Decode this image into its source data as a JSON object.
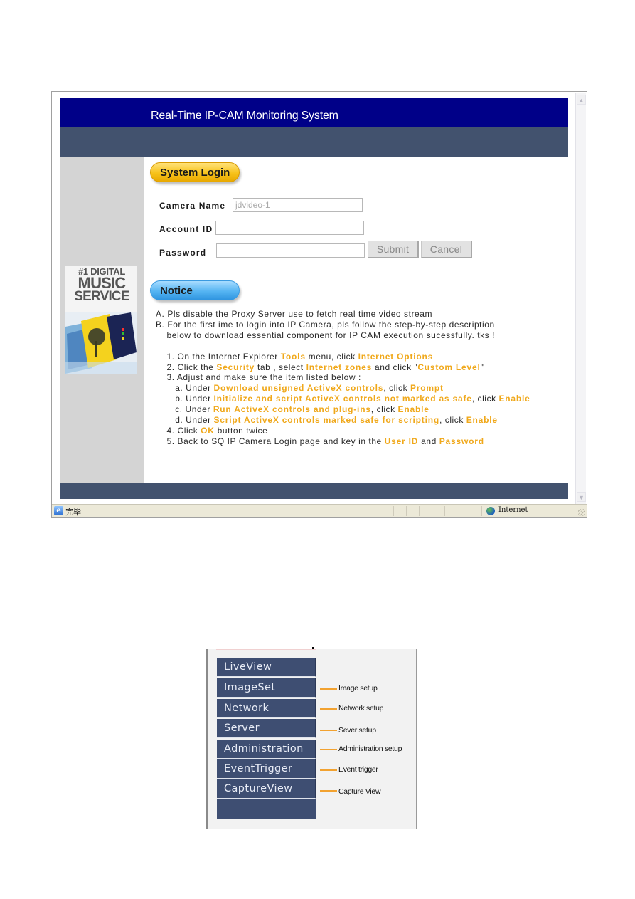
{
  "browser": {
    "header_title": "Real-Time IP-CAM Monitoring System",
    "ad": {
      "line1": "#1 DIGITAL",
      "line2": "MUSIC",
      "line3": "SERVICE"
    },
    "login": {
      "section_title": "System Login",
      "camera_name_label": "Camera Name",
      "camera_name_value": "jdvideo-1",
      "account_id_label": "Account ID",
      "account_id_value": "",
      "password_label": "Password",
      "password_value": "",
      "submit_label": "Submit",
      "cancel_label": "Cancel"
    },
    "notice": {
      "section_title": "Notice",
      "lines": [
        [
          {
            "t": "A. Pls disable the Proxy Server use to fetch real time video stream"
          }
        ],
        [
          {
            "t": "B. For the first ime to login into IP Camera, pls follow the step-by-step description"
          }
        ],
        [
          {
            "t": "    below to download essential component for IP CAM execution sucessfully. tks !"
          }
        ],
        [
          {
            "t": ""
          }
        ],
        [
          {
            "t": "    1. On the Internet Explorer "
          },
          {
            "t": "Tools",
            "h": true
          },
          {
            "t": " menu, click "
          },
          {
            "t": "Internet Options",
            "h": true
          }
        ],
        [
          {
            "t": "    2. Click the "
          },
          {
            "t": "Security",
            "h": true
          },
          {
            "t": " tab , select "
          },
          {
            "t": "Internet zones",
            "h": true
          },
          {
            "t": " and click \""
          },
          {
            "t": "Custom Level",
            "h": true
          },
          {
            "t": "\""
          }
        ],
        [
          {
            "t": "    3. Adjust and make sure the item listed below :"
          }
        ],
        [
          {
            "t": "       a. Under "
          },
          {
            "t": "Download unsigned ActiveX controls",
            "h": true
          },
          {
            "t": ", click "
          },
          {
            "t": "Prompt",
            "h": true
          }
        ],
        [
          {
            "t": "       b. Under "
          },
          {
            "t": "Initialize and script ActiveX controls not marked as safe",
            "h": true
          },
          {
            "t": ", click "
          },
          {
            "t": "Enable",
            "h": true
          }
        ],
        [
          {
            "t": "       c. Under "
          },
          {
            "t": "Run ActiveX controls and plug-ins",
            "h": true
          },
          {
            "t": ", click "
          },
          {
            "t": "Enable",
            "h": true
          }
        ],
        [
          {
            "t": "       d. Under "
          },
          {
            "t": "Script ActiveX controls marked safe for scripting",
            "h": true
          },
          {
            "t": ", click "
          },
          {
            "t": "Enable",
            "h": true
          }
        ],
        [
          {
            "t": "    4. Click "
          },
          {
            "t": "OK",
            "h": true
          },
          {
            "t": " button twice"
          }
        ],
        [
          {
            "t": "    5. Back to SQ IP Camera Login page and key in the "
          },
          {
            "t": "User ID",
            "h": true
          },
          {
            "t": " and "
          },
          {
            "t": "Password",
            "h": true
          }
        ]
      ]
    },
    "statusbar": {
      "status_text": "完毕",
      "zone_text": "Internet",
      "ie_icon": "e"
    },
    "scroll": {
      "up": "▲",
      "down": "▼"
    }
  },
  "menu": {
    "items": [
      {
        "label": "LiveView",
        "callout": ""
      },
      {
        "label": "ImageSet",
        "callout": "Image setup"
      },
      {
        "label": "Network",
        "callout": "Network setup"
      },
      {
        "label": "Server",
        "callout": "Sever setup"
      },
      {
        "label": "Administration",
        "callout": "Administration setup"
      },
      {
        "label": "EventTrigger",
        "callout": "Event trigger"
      },
      {
        "label": "CaptureView",
        "callout": "Capture View"
      }
    ]
  },
  "colors": {
    "header_blue": "#000088",
    "slate": "#42526e",
    "highlight": "#f0a81a",
    "menu_button": "#3e4e72",
    "callout_line": "#f2a230"
  }
}
